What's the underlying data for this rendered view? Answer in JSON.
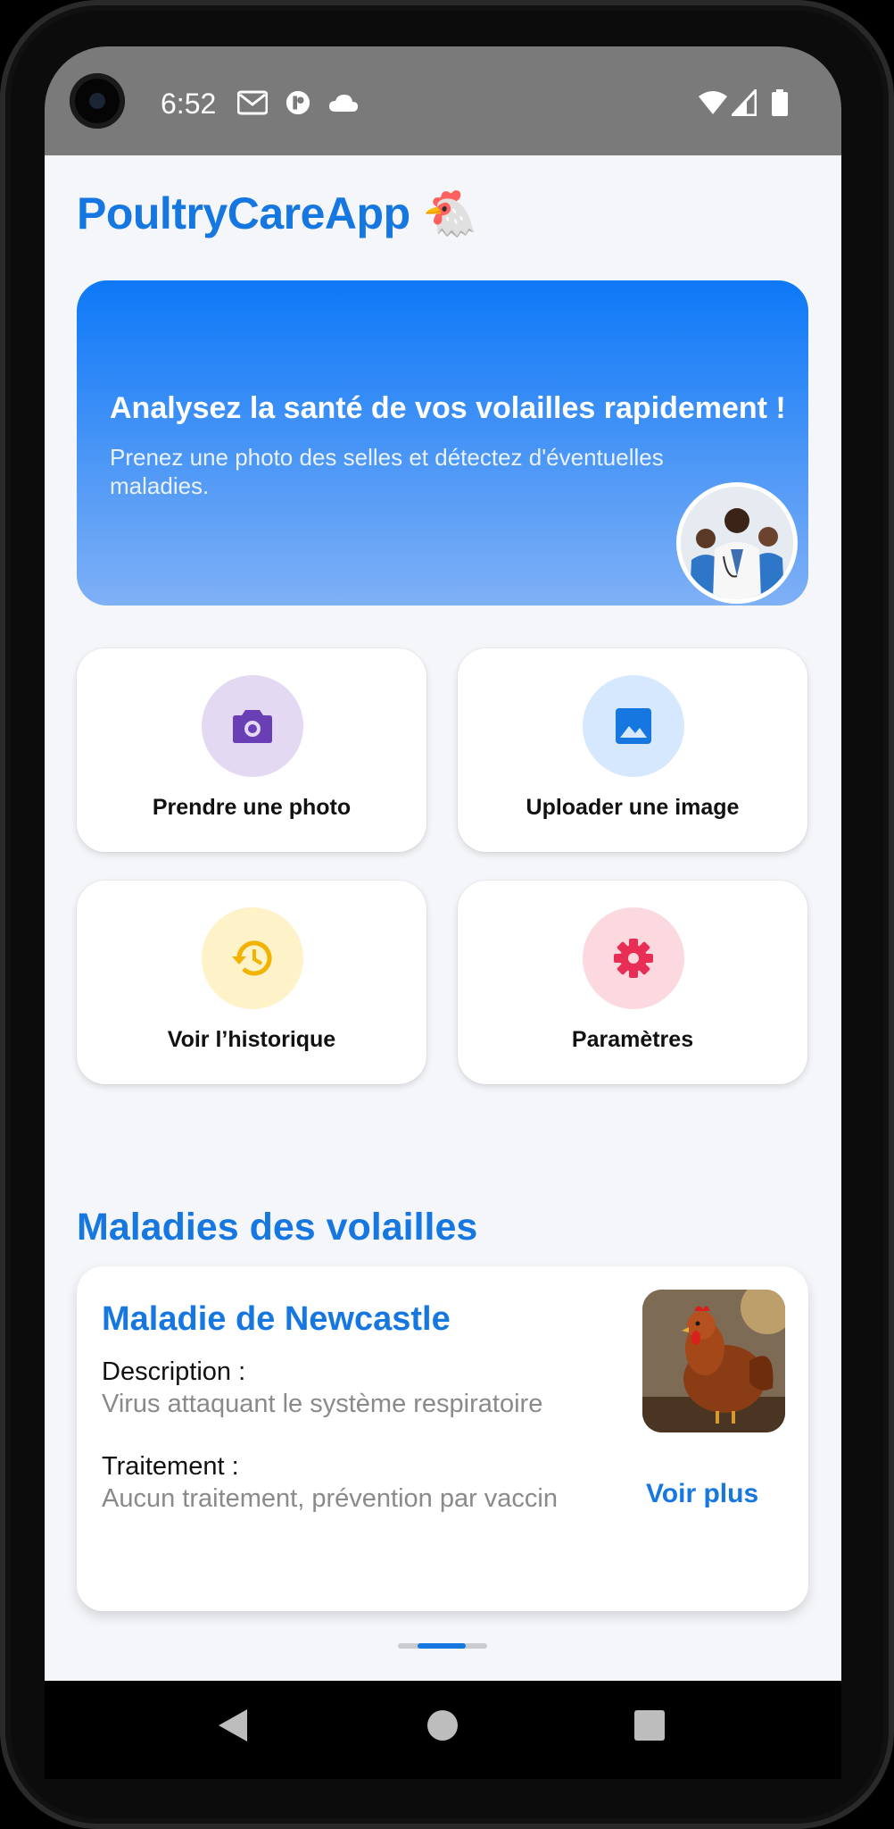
{
  "status_bar": {
    "time": "6:52",
    "left_icons": [
      "gmail-icon",
      "app-icon",
      "cloud-icon"
    ],
    "right_icons": [
      "wifi-icon",
      "signal-icon",
      "battery-icon"
    ]
  },
  "app": {
    "title": "PoultryCareApp",
    "title_emoji": "🐔"
  },
  "banner": {
    "title": "Analysez la santé de vos volailles rapidement !",
    "subtitle": "Prenez une photo des selles et détectez d'éventuelles maladies."
  },
  "actions": [
    {
      "label": "Prendre une photo",
      "icon": "camera-icon",
      "circle_color": "#e3d9f2",
      "icon_color": "#6a3fb5"
    },
    {
      "label": "Uploader une image",
      "icon": "image-icon",
      "circle_color": "#d6e8fd",
      "icon_color": "#1677e0"
    },
    {
      "label": "Voir l’historique",
      "icon": "history-icon",
      "circle_color": "#fdf2c8",
      "icon_color": "#f2b300"
    },
    {
      "label": "Paramètres",
      "icon": "gear-icon",
      "circle_color": "#fcd9df",
      "icon_color": "#e82e55"
    }
  ],
  "section": {
    "title": "Maladies des volailles"
  },
  "disease_card": {
    "title": "Maladie de Newcastle",
    "description_label": "Description :",
    "description": "Virus attaquant le système respiratoire",
    "treatment_label": "Traitement :",
    "treatment": "Aucun traitement, prévention par vaccin",
    "more_link": "Voir plus"
  },
  "colors": {
    "accent": "#1677e0",
    "background": "#f4f6fa"
  }
}
